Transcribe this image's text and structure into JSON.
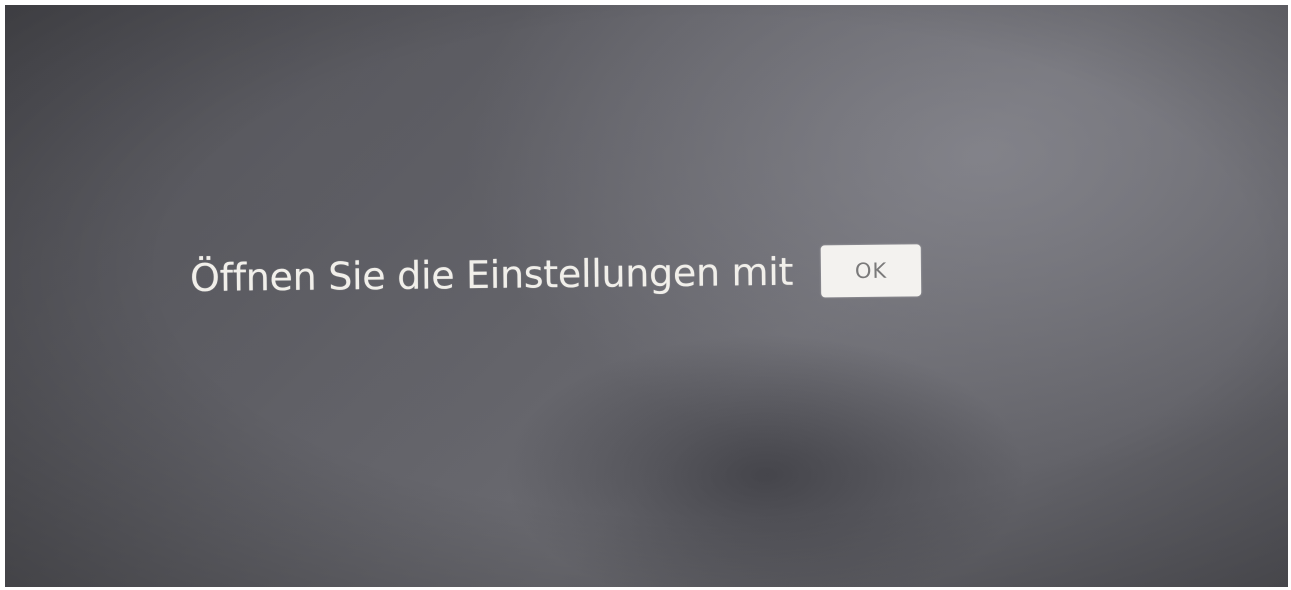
{
  "prompt": {
    "text": "Öffnen Sie die Einstellungen mit",
    "key_label": "OK"
  },
  "colors": {
    "background": "#626268",
    "text": "#f1efea",
    "key_background": "#f3f2ef",
    "key_text": "#7a7a7a"
  }
}
